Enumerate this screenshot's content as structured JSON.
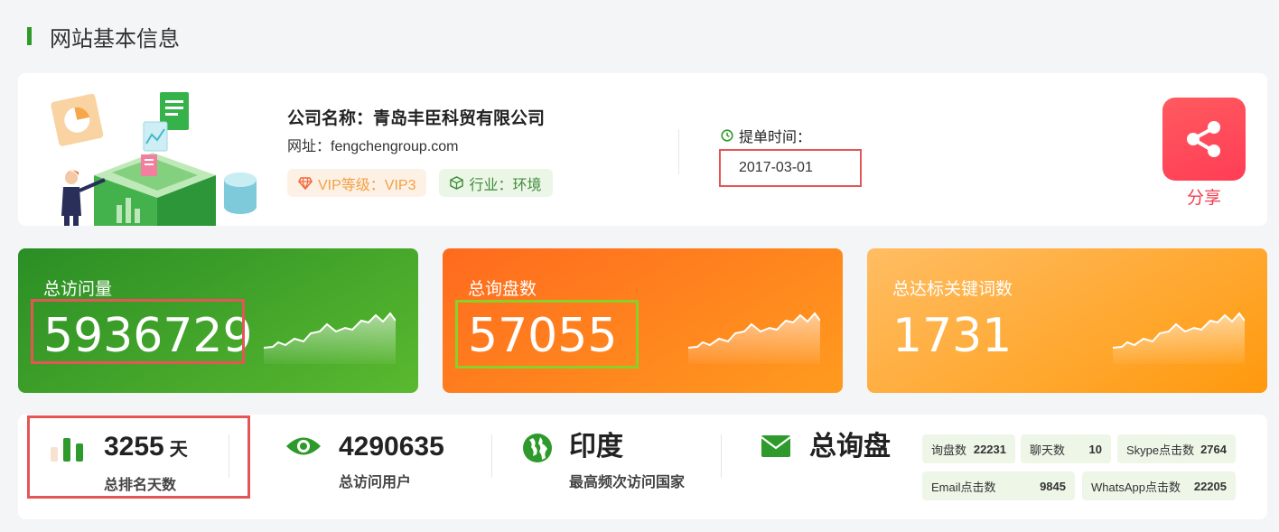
{
  "section": {
    "title": "网站基本信息"
  },
  "company": {
    "name_label": "公司名称：青岛丰臣科贸有限公司",
    "site_label": "网址：fengchengroup.com",
    "vip_tag": "VIP等级：VIP3",
    "industry_tag": "行业：环境"
  },
  "submit": {
    "label": "提单时间：",
    "date": "2017-03-01"
  },
  "share": {
    "label": "分享"
  },
  "stats": [
    {
      "label": "总访问量",
      "value": "5936729"
    },
    {
      "label": "总询盘数",
      "value": "57055"
    },
    {
      "label": "总达标关键词数",
      "value": "1731"
    }
  ],
  "metrics": {
    "rank": {
      "value": "3255",
      "unit": "天",
      "label": "总排名天数"
    },
    "visitors": {
      "value": "4290635",
      "label": "总访问用户"
    },
    "country": {
      "value": "印度",
      "label": "最高频次访问国家"
    },
    "inquiry": {
      "value": "总询盘"
    }
  },
  "chips": [
    {
      "label": "询盘数",
      "value": "22231"
    },
    {
      "label": "聊天数",
      "value": "10"
    },
    {
      "label": "Skype点击数",
      "value": "2764"
    },
    {
      "label": "Email点击数",
      "value": "9845"
    },
    {
      "label": "WhatsApp点击数",
      "value": "22205"
    }
  ],
  "colors": {
    "green": "#2e9a2b",
    "orange": "#ff7a1e",
    "red": "#e45656"
  },
  "icons": [
    "pie-chart-illustration",
    "share-icon",
    "clock-icon",
    "diamond-icon",
    "cube-icon",
    "bar-chart-icon",
    "eye-icon",
    "globe-icon",
    "mail-icon"
  ]
}
